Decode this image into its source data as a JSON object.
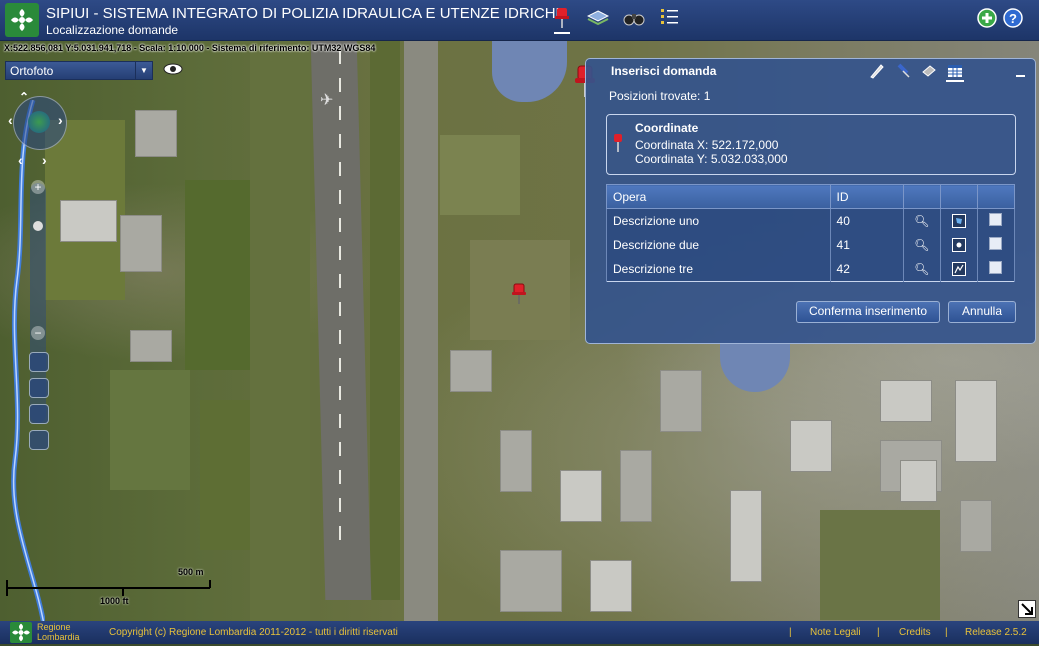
{
  "app": {
    "title": "SIPIUI - SISTEMA INTEGRATO DI POLIZIA IDRAULICA E UTENZE IDRICHE",
    "subtitle": "Localizzazione domande"
  },
  "header_icons": [
    "pushpin-icon",
    "layers-icon",
    "binoculars-icon",
    "list-icon",
    "add-icon",
    "help-icon"
  ],
  "coordinates_bar": "X:522.856,081 Y:5.031.941,718 - Scala: 1:10.000 - Sistema di riferimento: UTM32 WGS84",
  "basemap": {
    "selected": "Ortofoto"
  },
  "panel": {
    "title": "Inserisci domanda",
    "found": "Posizioni trovate: 1",
    "coordinates": {
      "title": "Coordinate",
      "x": "Coordinata X: 522.172,000",
      "y": "Coordinata Y: 5.032.033,000"
    },
    "table": {
      "headers": [
        "Opera",
        "ID",
        "",
        "",
        ""
      ],
      "rows": [
        {
          "opera": "Descrizione uno",
          "id": "40",
          "geom_icon": "polygon-icon"
        },
        {
          "opera": "Descrizione due",
          "id": "41",
          "geom_icon": "point-icon"
        },
        {
          "opera": "Descrizione tre",
          "id": "42",
          "geom_icon": "line-icon"
        }
      ]
    },
    "confirm_label": "Conferma inserimento",
    "cancel_label": "Annulla"
  },
  "scale": {
    "metric": "500 m",
    "imperial": "1000 ft"
  },
  "footer": {
    "logo_text_1": "Regione",
    "logo_text_2": "Lombardia",
    "copyright": "Copyright (c) Regione Lombardia 2011-2012 - tutti i diritti riservati",
    "legal": "Note Legali",
    "credits": "Credits",
    "release": "Release 2.5.2"
  },
  "colors": {
    "header": "#1d3568",
    "panel": "#34548c",
    "footer_text": "#e8c23a",
    "marker": "#e0202a"
  }
}
